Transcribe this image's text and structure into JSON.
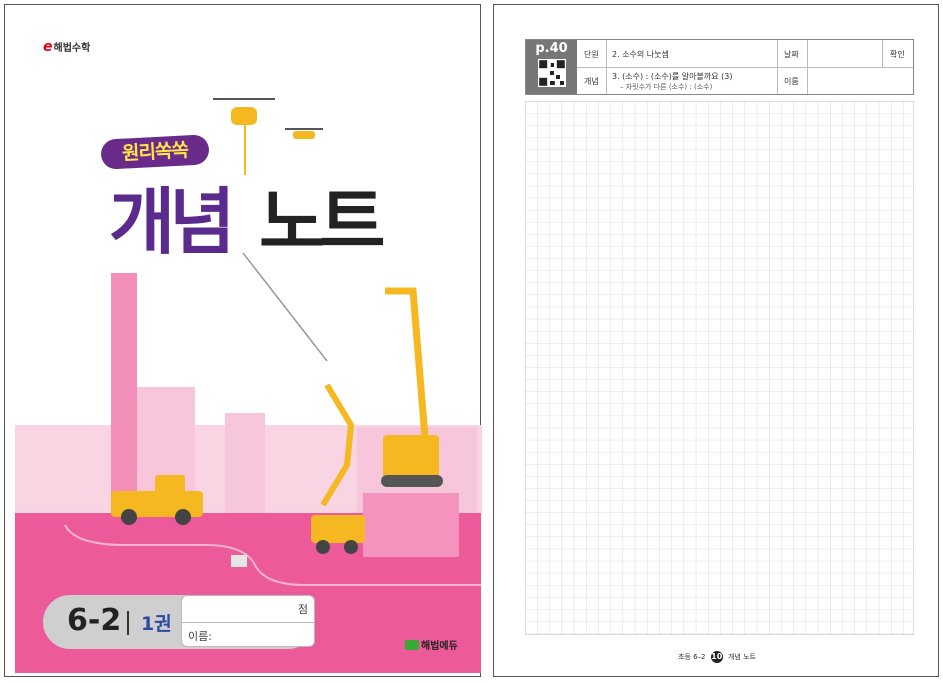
{
  "cover": {
    "publisher_logo": "해법수학",
    "series_name": "원리쏙쏙",
    "title_word1": "개념",
    "title_word2": "노트",
    "grade": "6-2",
    "volume": "1권",
    "score_label": "점",
    "name_label": "이름:",
    "bottom_logo": "해법에듀",
    "colors": {
      "pink": "#ec5a9a",
      "purple": "#5a2a8c",
      "yellow": "#f5b820"
    }
  },
  "note_page": {
    "page_ref": "p.40",
    "unit_label": "단원",
    "unit_value": "2. 소수의 나눗셈",
    "date_label": "날짜",
    "check_label": "확인",
    "concept_label": "개념",
    "concept_value": "3. (소수) : (소수)를 알아볼까요 (3)",
    "concept_sub": "– 자릿수가 다른 (소수) : (소수)",
    "name_label": "이름",
    "footer_prefix": "초등 6–2",
    "footer_page": "10",
    "footer_suffix": "개념 노트"
  }
}
